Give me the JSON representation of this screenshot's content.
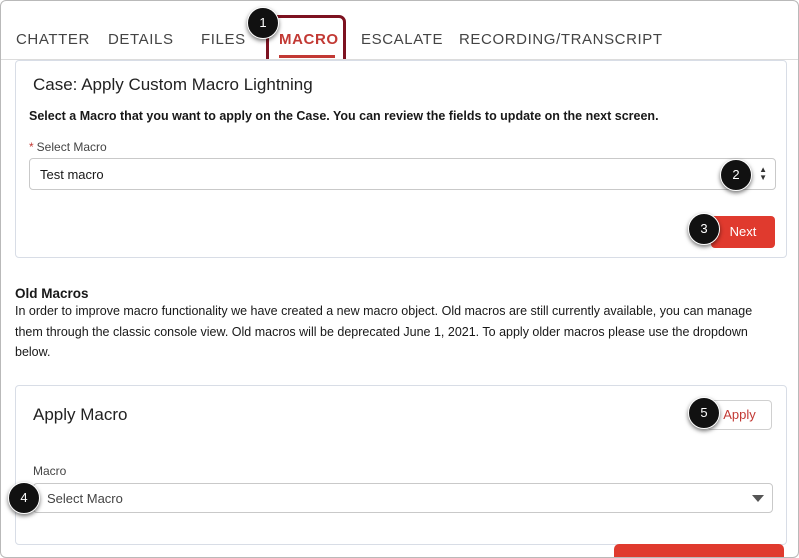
{
  "tabs": [
    {
      "label": "CHATTER"
    },
    {
      "label": "DETAILS"
    },
    {
      "label": "FILES"
    },
    {
      "label": "MACRO"
    },
    {
      "label": "ESCALATE"
    },
    {
      "label": "RECORDING/TRANSCRIPT"
    }
  ],
  "active_tab": "MACRO",
  "custom_macro": {
    "title": "Case: Apply Custom Macro Lightning",
    "instruction": "Select a Macro that you want to apply on the Case. You can review the fields to update on the next screen.",
    "required_marker": "*",
    "field_label": "Select Macro",
    "field_value": "Test macro",
    "next_label": "Next"
  },
  "old_macros": {
    "heading": "Old Macros",
    "paragraph": "In order to improve macro functionality we have created a new macro object. Old macros are still currently available, you can manage them through the classic console view.  Old macros will be deprecated June 1, 2021. To apply older macros please use the dropdown below."
  },
  "apply_macro": {
    "title": "Apply Macro",
    "apply_label": "Apply",
    "field_label": "Macro",
    "placeholder": "Select Macro"
  },
  "badges": [
    "1",
    "2",
    "3",
    "4",
    "5"
  ],
  "colors": {
    "brand": "#e03a2e",
    "active_tab": "#c23934",
    "highlight": "#7d1220",
    "badge": "#111111"
  }
}
